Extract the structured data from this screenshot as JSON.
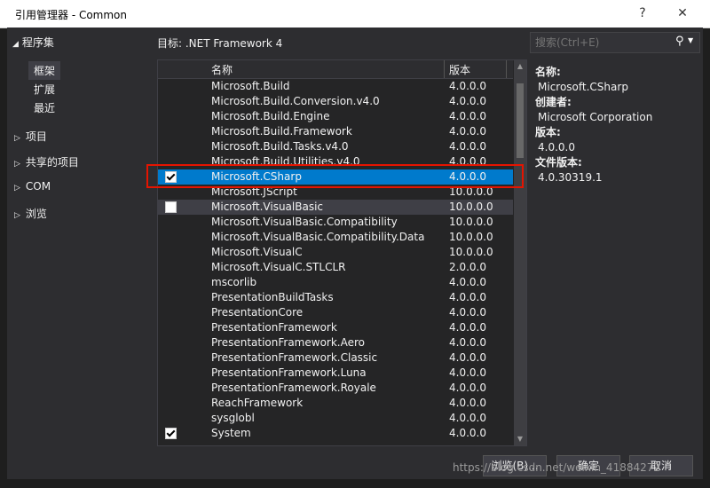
{
  "window": {
    "title": "引用管理器 - Common",
    "help": "?",
    "close": "✕"
  },
  "nav": {
    "assemblies_header": "程序集",
    "items": [
      {
        "label": "框架"
      },
      {
        "label": "扩展"
      },
      {
        "label": "最近"
      }
    ],
    "groups": [
      {
        "label": "项目"
      },
      {
        "label": "共享的项目"
      },
      {
        "label": "COM"
      },
      {
        "label": "浏览"
      }
    ]
  },
  "target_label": "目标: .NET Framework 4",
  "search": {
    "placeholder": "搜索(Ctrl+E)"
  },
  "list": {
    "columns": {
      "name": "名称",
      "version": "版本"
    },
    "rows": [
      {
        "name": "Microsoft.Build",
        "version": "4.0.0.0",
        "checked": false
      },
      {
        "name": "Microsoft.Build.Conversion.v4.0",
        "version": "4.0.0.0",
        "checked": false
      },
      {
        "name": "Microsoft.Build.Engine",
        "version": "4.0.0.0",
        "checked": false
      },
      {
        "name": "Microsoft.Build.Framework",
        "version": "4.0.0.0",
        "checked": false
      },
      {
        "name": "Microsoft.Build.Tasks.v4.0",
        "version": "4.0.0.0",
        "checked": false
      },
      {
        "name": "Microsoft.Build.Utilities.v4.0",
        "version": "4.0.0.0",
        "checked": false
      },
      {
        "name": "Microsoft.CSharp",
        "version": "4.0.0.0",
        "checked": true,
        "selected": true
      },
      {
        "name": "Microsoft.JScript",
        "version": "10.0.0.0",
        "checked": false
      },
      {
        "name": "Microsoft.VisualBasic",
        "version": "10.0.0.0",
        "checked": false,
        "hover": true
      },
      {
        "name": "Microsoft.VisualBasic.Compatibility",
        "version": "10.0.0.0",
        "checked": false
      },
      {
        "name": "Microsoft.VisualBasic.Compatibility.Data",
        "version": "10.0.0.0",
        "checked": false
      },
      {
        "name": "Microsoft.VisualC",
        "version": "10.0.0.0",
        "checked": false
      },
      {
        "name": "Microsoft.VisualC.STLCLR",
        "version": "2.0.0.0",
        "checked": false
      },
      {
        "name": "mscorlib",
        "version": "4.0.0.0",
        "checked": false
      },
      {
        "name": "PresentationBuildTasks",
        "version": "4.0.0.0",
        "checked": false
      },
      {
        "name": "PresentationCore",
        "version": "4.0.0.0",
        "checked": false
      },
      {
        "name": "PresentationFramework",
        "version": "4.0.0.0",
        "checked": false
      },
      {
        "name": "PresentationFramework.Aero",
        "version": "4.0.0.0",
        "checked": false
      },
      {
        "name": "PresentationFramework.Classic",
        "version": "4.0.0.0",
        "checked": false
      },
      {
        "name": "PresentationFramework.Luna",
        "version": "4.0.0.0",
        "checked": false
      },
      {
        "name": "PresentationFramework.Royale",
        "version": "4.0.0.0",
        "checked": false
      },
      {
        "name": "ReachFramework",
        "version": "4.0.0.0",
        "checked": false
      },
      {
        "name": "sysglobl",
        "version": "4.0.0.0",
        "checked": false
      },
      {
        "name": "System",
        "version": "4.0.0.0",
        "checked": true
      }
    ]
  },
  "details": {
    "name_label": "名称:",
    "name_value": "Microsoft.CSharp",
    "creator_label": "创建者:",
    "creator_value": "Microsoft Corporation",
    "version_label": "版本:",
    "version_value": "4.0.0.0",
    "file_version_label": "文件版本:",
    "file_version_value": "4.0.30319.1"
  },
  "buttons": {
    "browse": "浏览(B)...",
    "ok": "确定",
    "cancel": "取消"
  },
  "watermark": "https://blog.csdn.net/weixin_41884272",
  "colors": {
    "accent": "#007acc",
    "highlight_border": "#e51400",
    "dialog_bg": "#2d2d30"
  }
}
